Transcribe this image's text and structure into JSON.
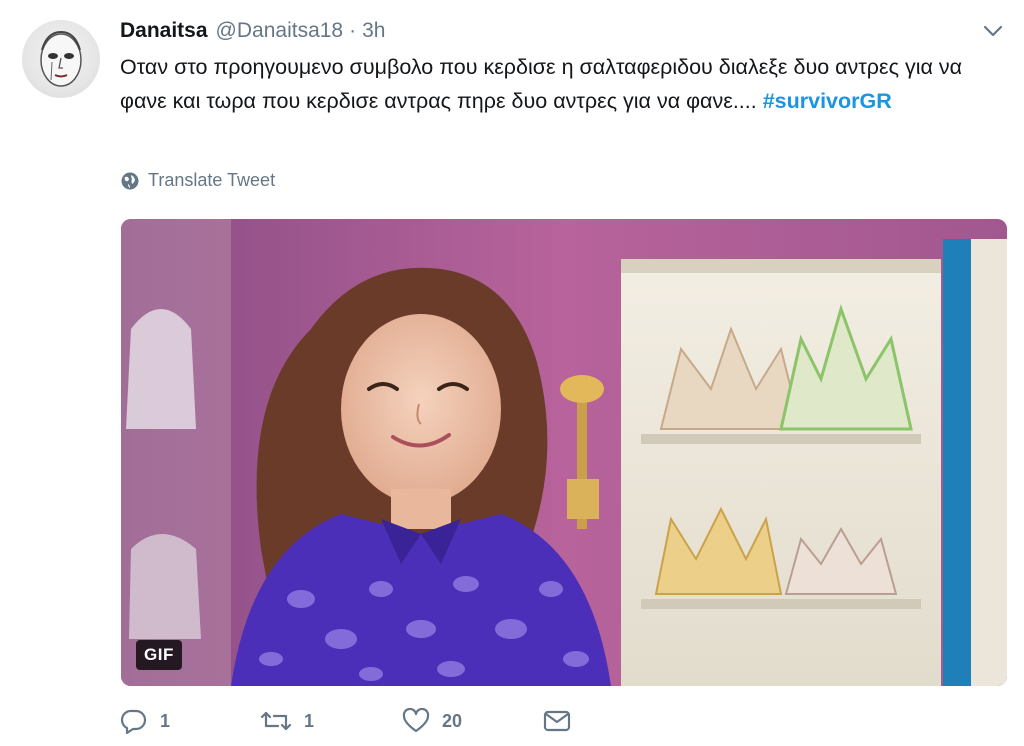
{
  "tweet": {
    "author_name": "Danaitsa",
    "author_handle": "@Danaitsa18",
    "separator": "·",
    "time": "3h",
    "text_main": "Οταν στο προηγουμενο συμβολο που κερδισε η σαλταφεριδου διαλεξε δυο αντρες για να φανε και τωρα που κερδισε αντρας πηρε δυο αντρες για να φανε....",
    "hashtag": "#survivorGR",
    "translate_label": "Translate Tweet",
    "media_badge": "GIF"
  },
  "actions": {
    "reply_count": "1",
    "retweet_count": "1",
    "like_count": "20"
  },
  "colors": {
    "link": "#1b95e0",
    "muted": "#657786",
    "text": "#14171a"
  },
  "icons": [
    "reply-icon",
    "retweet-icon",
    "like-icon",
    "direct-message-icon",
    "globe-icon",
    "caret-down-icon"
  ]
}
